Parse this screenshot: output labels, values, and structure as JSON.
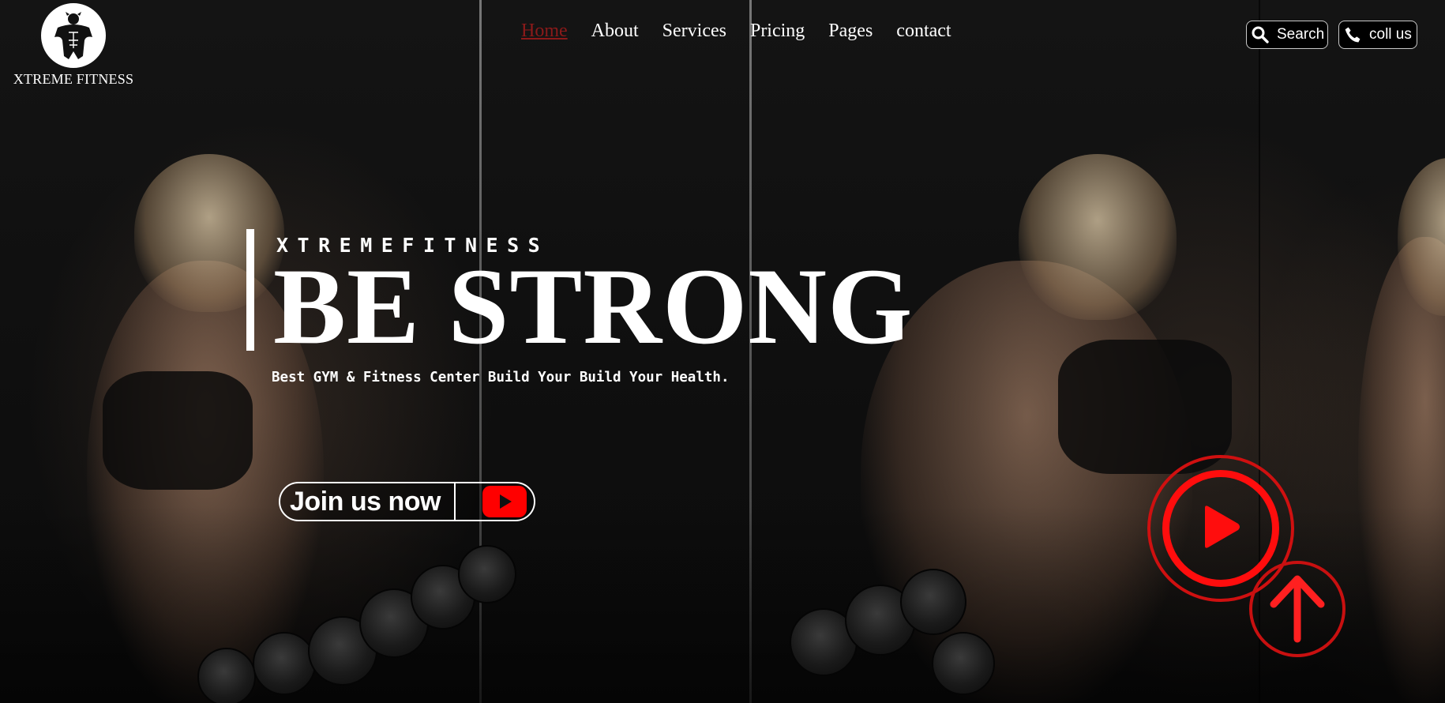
{
  "brand": {
    "name": "XTREME FITNESS",
    "logo_icon": "bodybuilder-emblem-icon"
  },
  "nav": {
    "items": [
      {
        "label": "Home",
        "active": true
      },
      {
        "label": "About",
        "active": false
      },
      {
        "label": "Services",
        "active": false
      },
      {
        "label": "Pricing",
        "active": false
      },
      {
        "label": "Pages",
        "active": false
      },
      {
        "label": "contact",
        "active": false
      }
    ],
    "active_color": "#8b1a1a"
  },
  "header_actions": {
    "search_label": "Search",
    "search_icon": "search-icon",
    "call_label": "coll us",
    "call_icon": "phone-icon"
  },
  "hero": {
    "kicker": "XTREMEFITNESS",
    "title": "BE STRONG",
    "subtitle": "Best GYM & Fitness Center Build Your Build Your Health."
  },
  "cta": {
    "join_label": "Join us now",
    "join_icon": "youtube-icon"
  },
  "floating_controls": {
    "play_icon": "play-video-icon",
    "back_to_top_icon": "arrow-up-icon",
    "accent_color": "#ff0d0d"
  }
}
